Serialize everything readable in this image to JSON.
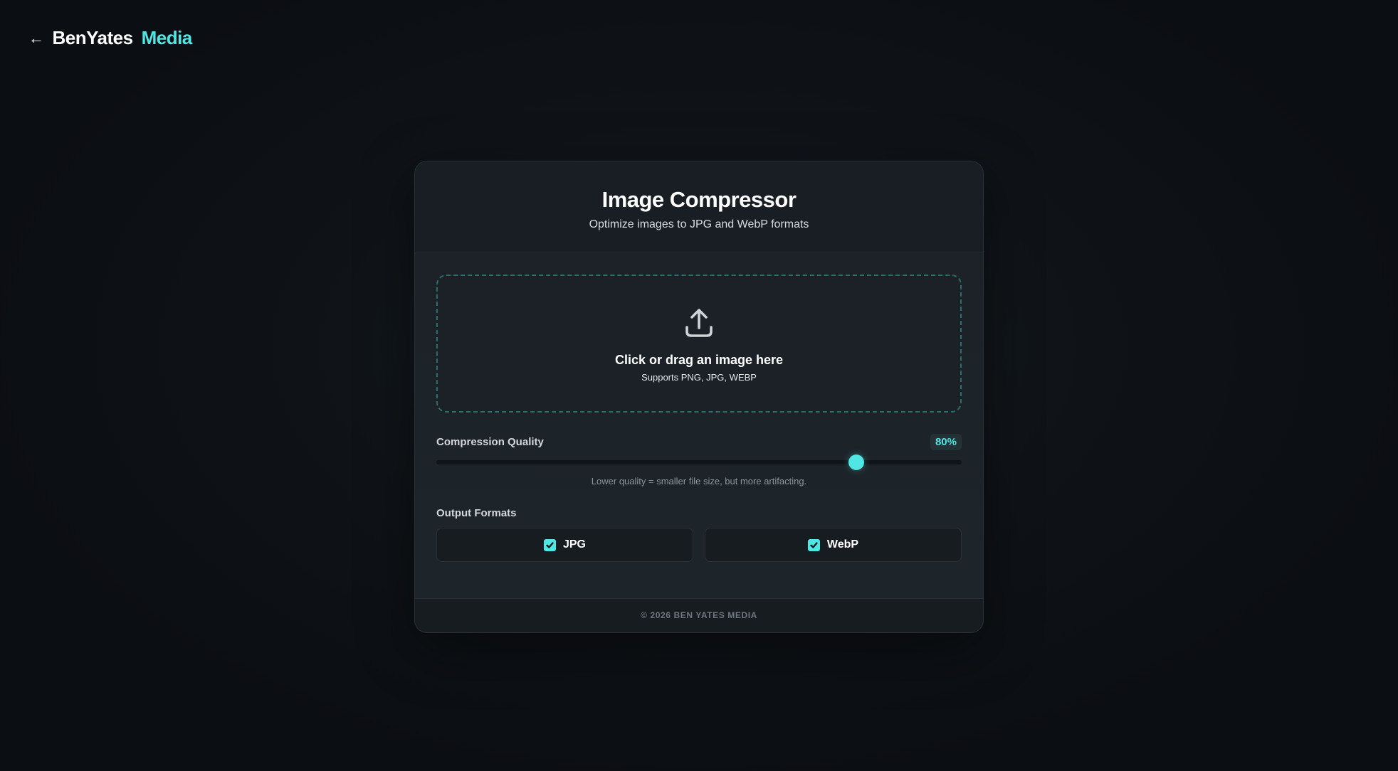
{
  "brand": {
    "back_arrow": "←",
    "name_primary": "BenYates",
    "name_accent": "Media"
  },
  "card": {
    "title": "Image Compressor",
    "subtitle": "Optimize images to JPG and WebP formats"
  },
  "dropzone": {
    "icon": "upload-icon",
    "title": "Click or drag an image here",
    "hint": "Supports PNG, JPG, WEBP"
  },
  "quality": {
    "label": "Compression Quality",
    "value": 80,
    "value_display": "80%",
    "help": "Lower quality = smaller file size, but more artifacting."
  },
  "formats": {
    "label": "Output Formats",
    "options": [
      {
        "label": "JPG",
        "checked": true
      },
      {
        "label": "WebP",
        "checked": true
      }
    ]
  },
  "footer": {
    "text": "© 2026 BEN YATES MEDIA"
  },
  "colors": {
    "accent": "#4fe6e3",
    "background": "#0f1317",
    "card": "#1a1f25"
  }
}
